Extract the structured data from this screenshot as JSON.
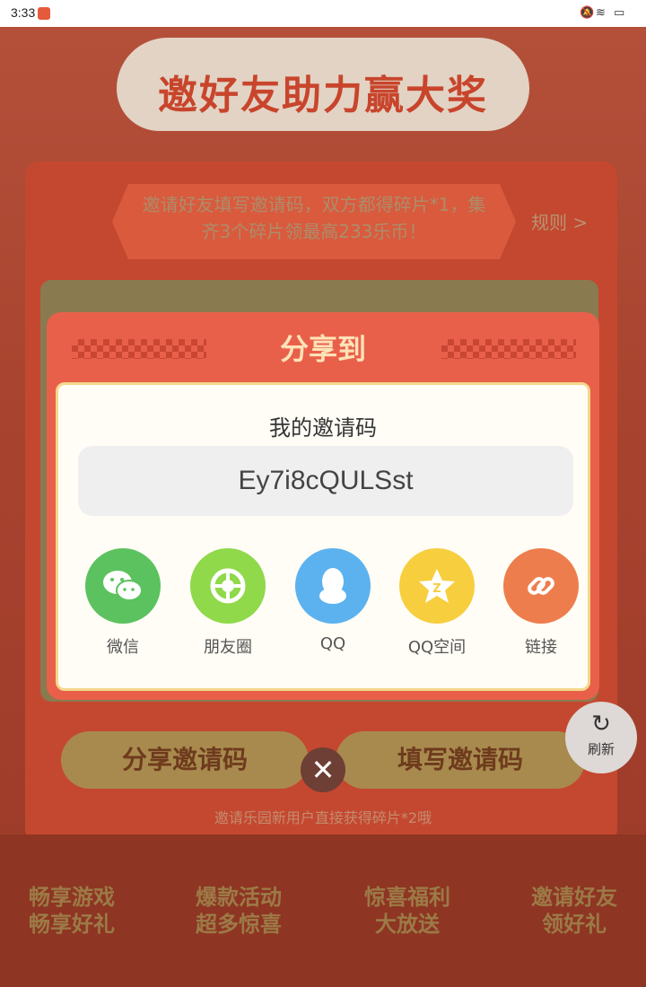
{
  "status_bar": {
    "time": "3:33"
  },
  "header": {
    "title": "邀好友助力赢大奖"
  },
  "banner": {
    "text": "邀请好友填写邀请码，双方都得碎片*1，集齐3个碎片领最高233乐币！",
    "rules": "规则 >"
  },
  "modal": {
    "title": "分享到",
    "code_label": "我的邀请码",
    "code": "Ey7i8cQULSst",
    "share_targets": [
      {
        "label": "微信",
        "icon": "wechat-icon",
        "color": "#5cc25f"
      },
      {
        "label": "朋友圈",
        "icon": "moments-icon",
        "color": "#8fd94a"
      },
      {
        "label": "QQ",
        "icon": "qq-icon",
        "color": "#5bb2ef"
      },
      {
        "label": "QQ空间",
        "icon": "qzone-icon",
        "color": "#f7ce3e"
      },
      {
        "label": "链接",
        "icon": "link-icon",
        "color": "#ee7d4d"
      }
    ]
  },
  "buttons": {
    "share_code": "分享邀请码",
    "enter_code": "填写邀请码"
  },
  "note": "邀请乐园新用户直接获得碎片*2哦",
  "refresh": {
    "label": "刷新"
  },
  "features": [
    {
      "line1": "畅享游戏",
      "line2": "畅享好礼"
    },
    {
      "line1": "爆款活动",
      "line2": "超多惊喜"
    },
    {
      "line1": "惊喜福利",
      "line2": "大放送"
    },
    {
      "line1": "邀请好友",
      "line2": "领好礼"
    }
  ]
}
